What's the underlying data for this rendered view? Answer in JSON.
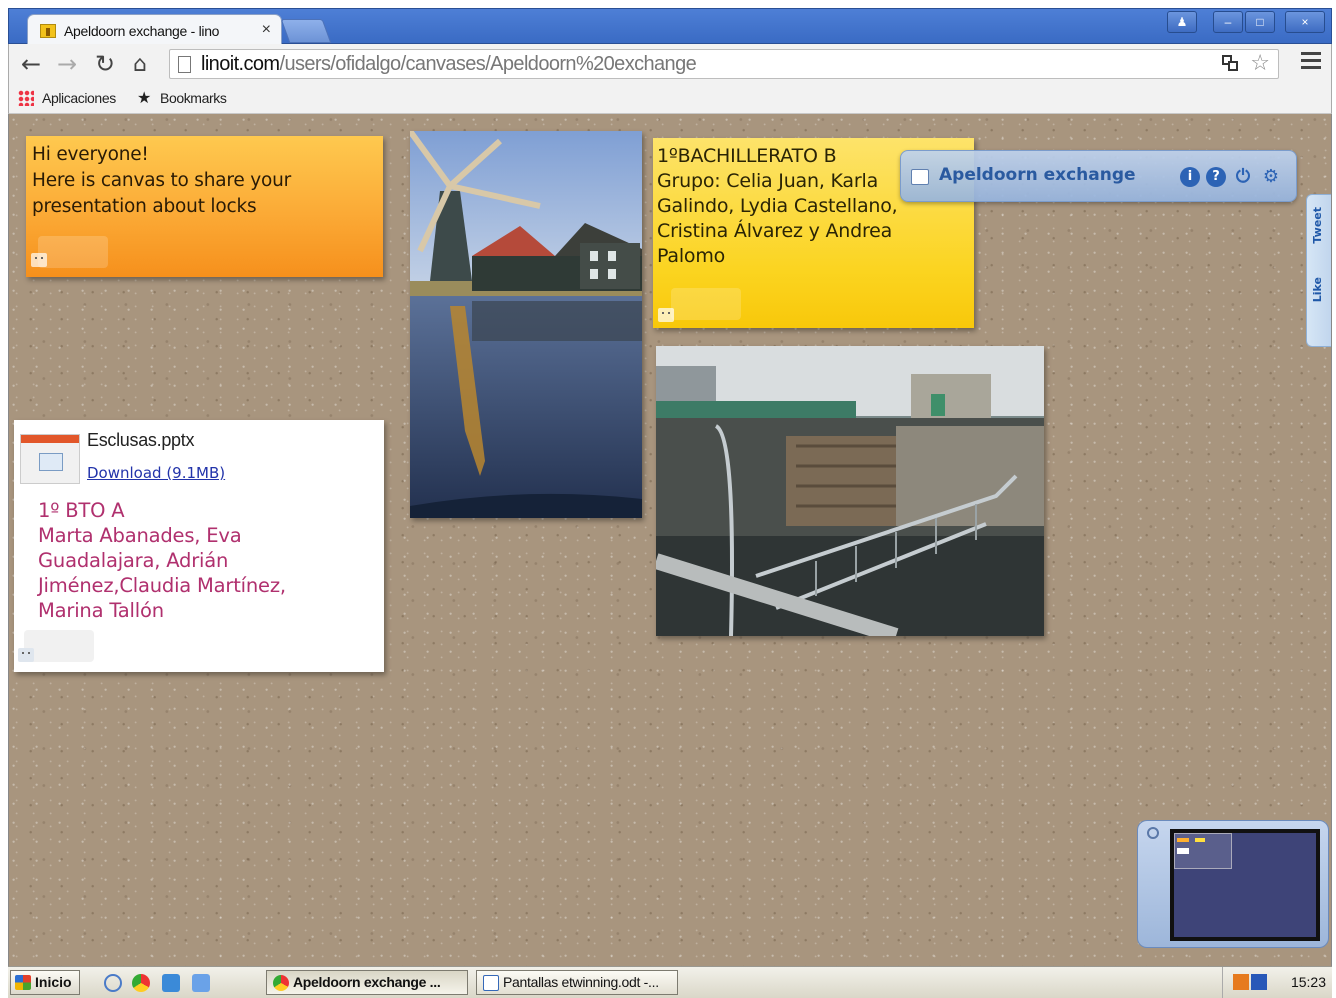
{
  "browser": {
    "tab_title": "Apeldoorn exchange - lino",
    "tab_close": "×",
    "window_buttons": [
      "–",
      "□",
      "×"
    ],
    "url_host": "linoit.com",
    "url_path": "/users/ofidalgo/canvases/Apeldoorn%20exchange",
    "bookmarks": [
      "Aplicaciones",
      "Bookmarks"
    ]
  },
  "board": {
    "title": "Apeldoorn exchange",
    "header_icons": [
      "info-icon",
      "help-icon",
      "power-icon",
      "settings-icon"
    ],
    "social": [
      "Like",
      "Tweet"
    ]
  },
  "notes": {
    "orange": {
      "lines": [
        "Hi everyone!",
        "Here is canvas to share your",
        "presentation about locks"
      ],
      "color": "#fbaa36"
    },
    "yellow": {
      "lines": [
        "1ºBACHILLERATO B",
        "Grupo: Celia Juan, Karla",
        "Galindo, Lydia Castellano,",
        "Cristina Álvarez y Andrea",
        "Palomo"
      ],
      "color": "#fbd420"
    },
    "white": {
      "file_name": "Esclusas.pptx",
      "download_link": "Download (9.1MB)",
      "lines": [
        "1º BTO A",
        "Marta Abanades, Eva",
        "Guadalajara, Adrián",
        "Jiménez,Claudia Martínez,",
        "Marina Tallón"
      ],
      "text_color": "#b0306e"
    }
  },
  "photos": [
    "windmill-photo",
    "canal-lock-photo"
  ],
  "taskbar": {
    "start_label": "Inicio",
    "tasks": [
      "Apeldoorn exchange ...",
      "Pantallas etwinning.odt -..."
    ],
    "clock": "15:23"
  }
}
